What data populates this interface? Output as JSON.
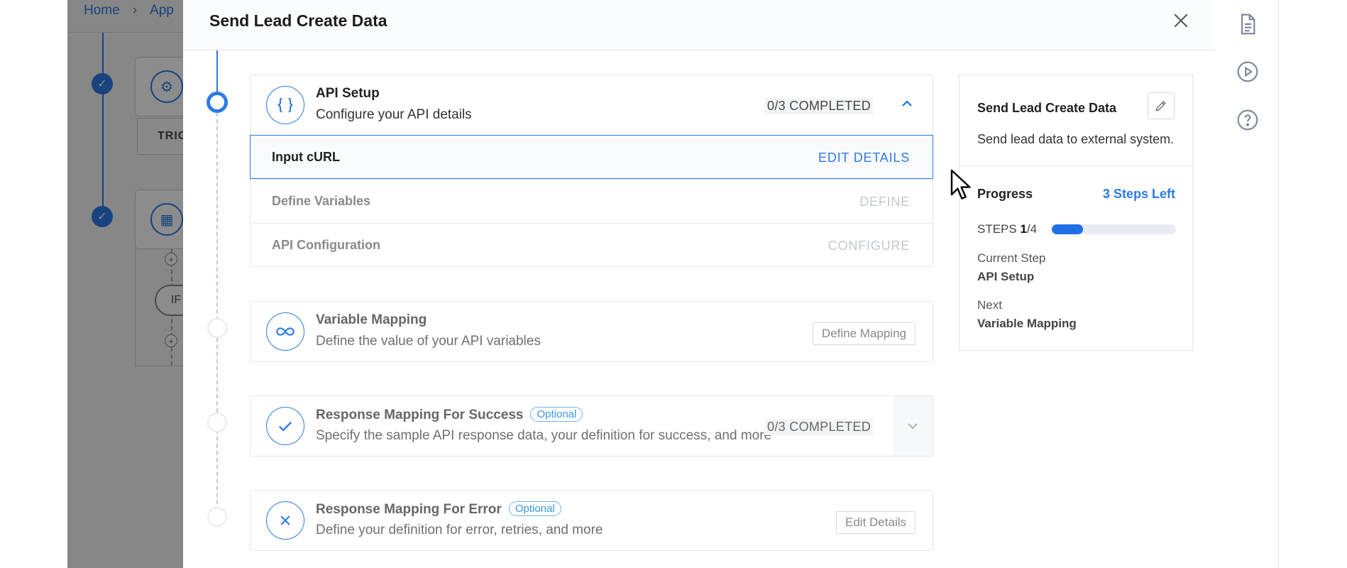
{
  "background": {
    "breadcrumb": [
      "Home",
      "App"
    ],
    "trigger_label": "TRIG",
    "if_label": "IF"
  },
  "modal": {
    "title": "Send Lead Create Data"
  },
  "steps": [
    {
      "title": "API Setup",
      "description": "Configure your API details",
      "status": "0/3 COMPLETED",
      "substeps": [
        {
          "label": "Input cURL",
          "action": "EDIT DETAILS"
        },
        {
          "label": "Define Variables",
          "action": "DEFINE"
        },
        {
          "label": "API Configuration",
          "action": "CONFIGURE"
        }
      ]
    },
    {
      "title": "Variable Mapping",
      "description": "Define the value of your API variables",
      "button": "Define Mapping"
    },
    {
      "title": "Response Mapping For Success",
      "badge": "Optional",
      "description": "Specify the sample API response data, your definition for success, and more",
      "status": "0/3 COMPLETED"
    },
    {
      "title": "Response Mapping For Error",
      "badge": "Optional",
      "description": "Define your definition for error, retries, and more",
      "button": "Edit Details"
    }
  ],
  "summary": {
    "title": "Send Lead Create Data",
    "description": "Send lead data to external system.",
    "progress_label": "Progress",
    "steps_left": "3 Steps Left",
    "steps_prefix": "STEPS",
    "steps_current": "1",
    "steps_total": "/4",
    "progress_fraction": 0.25,
    "current_step_label": "Current Step",
    "current_step": "API Setup",
    "next_label": "Next",
    "next_step": "Variable Mapping"
  },
  "colors": {
    "accent": "#2c7be5"
  }
}
